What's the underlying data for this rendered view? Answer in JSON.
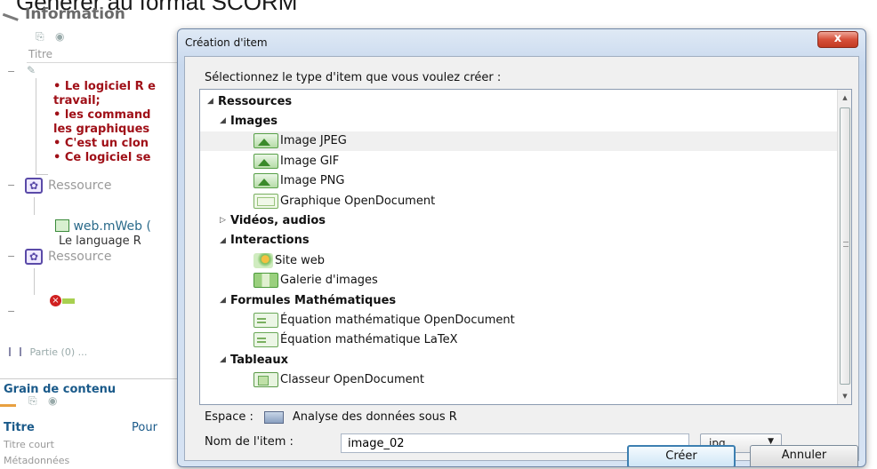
{
  "background": {
    "heading": "Générer au format SCORM",
    "info_title": "Information",
    "titre_label": "Titre",
    "bullets": [
      "• Le logiciel R e",
      "travail;",
      "• les command",
      "les graphiques",
      "• C'est un clon",
      "• Ce logiciel se"
    ],
    "ressource_label": "Ressource",
    "web_item": "web.mWeb (",
    "web_subtitle": "Le language R",
    "partie_label": "Partie (0) ...",
    "grain_title": "Grain de contenu",
    "titre2_label": "Titre",
    "titre2_value": "Pour",
    "titre_court_label": "Titre court",
    "metadonnees_label": "Métadonnées"
  },
  "dialog": {
    "title": "Création d'item",
    "close_label": "x",
    "prompt": "Sélectionnez le type d'item que vous voulez créer :",
    "tree": [
      {
        "label": "Ressources",
        "level": 0,
        "kind": "group",
        "expanded": true
      },
      {
        "label": "Images",
        "level": 1,
        "kind": "group",
        "expanded": true
      },
      {
        "label": "Image JPEG",
        "level": 2,
        "kind": "item",
        "icon": "image-icon",
        "selected": true
      },
      {
        "label": "Image GIF",
        "level": 2,
        "kind": "item",
        "icon": "image-icon"
      },
      {
        "label": "Image PNG",
        "level": 2,
        "kind": "item",
        "icon": "image-icon"
      },
      {
        "label": "Graphique OpenDocument",
        "level": 2,
        "kind": "item",
        "icon": "chart-icon"
      },
      {
        "label": "Vidéos, audios",
        "level": 1,
        "kind": "group",
        "expanded": false
      },
      {
        "label": "Interactions",
        "level": 1,
        "kind": "group",
        "expanded": true
      },
      {
        "label": "Site web",
        "level": 2,
        "kind": "item",
        "icon": "website-icon"
      },
      {
        "label": "Galerie d'images",
        "level": 2,
        "kind": "item",
        "icon": "gallery-icon"
      },
      {
        "label": "Formules Mathématiques",
        "level": 1,
        "kind": "group",
        "expanded": true
      },
      {
        "label": "Équation mathématique OpenDocument",
        "level": 2,
        "kind": "item",
        "icon": "equation-icon"
      },
      {
        "label": "Équation mathématique LaTeX",
        "level": 2,
        "kind": "item",
        "icon": "equation-icon"
      },
      {
        "label": "Tableaux",
        "level": 1,
        "kind": "group",
        "expanded": true
      },
      {
        "label": "Classeur OpenDocument",
        "level": 2,
        "kind": "item",
        "icon": "spreadsheet-icon"
      }
    ],
    "space_label": "Espace :",
    "space_value": "Analyse des données sous R",
    "name_label": "Nom de l'item :",
    "name_value": "image_02",
    "extension": "jpg",
    "create_label": "Créer",
    "cancel_label": "Annuler"
  }
}
